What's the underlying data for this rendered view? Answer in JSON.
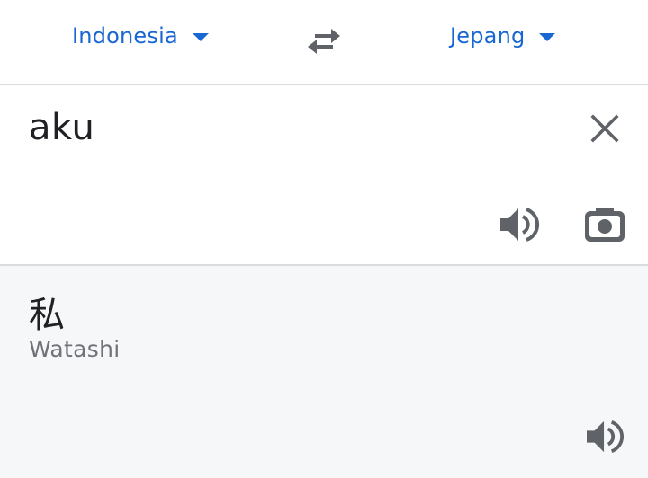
{
  "language_bar": {
    "source_language": "Indonesia",
    "target_language": "Jepang",
    "swap_icon": "swap-arrows-icon",
    "dropdown_icon": "caret-down-icon"
  },
  "input": {
    "text": "aku",
    "clear_icon": "close-icon",
    "listen_icon": "speaker-icon",
    "camera_icon": "camera-icon"
  },
  "output": {
    "translation": "私",
    "romanization": "Watashi",
    "listen_icon": "speaker-icon"
  },
  "colors": {
    "accent": "#1967d2",
    "icon_gray": "#5f6368",
    "divider": "#dadce0",
    "output_background": "#f6f7f9",
    "text_primary": "#202124",
    "text_secondary": "#6f7378"
  }
}
